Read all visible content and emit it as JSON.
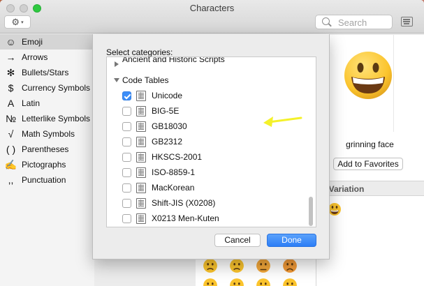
{
  "window": {
    "title": "Characters"
  },
  "toolbar": {
    "search_placeholder": "Search"
  },
  "sidebar": {
    "items": [
      {
        "label": "Emoji",
        "icon": "☺",
        "icon_name": "smiley-icon",
        "selected": true
      },
      {
        "label": "Arrows",
        "icon": "→",
        "icon_name": "arrow-icon"
      },
      {
        "label": "Bullets/Stars",
        "icon": "✻",
        "icon_name": "asterisk-icon"
      },
      {
        "label": "Currency Symbols",
        "icon": "$",
        "icon_name": "dollar-icon"
      },
      {
        "label": "Latin",
        "icon": "A",
        "icon_name": "latin-a-icon"
      },
      {
        "label": "Letterlike Symbols",
        "icon": "№",
        "icon_name": "numero-icon"
      },
      {
        "label": "Math Symbols",
        "icon": "√",
        "icon_name": "square-root-icon"
      },
      {
        "label": "Parentheses",
        "icon": "( )",
        "icon_name": "parentheses-icon"
      },
      {
        "label": "Pictographs",
        "icon": "✍",
        "icon_name": "writing-hand-icon"
      },
      {
        "label": "Punctuation",
        "icon": ",,",
        "icon_name": "punctuation-icon"
      }
    ]
  },
  "detail": {
    "character_name": "grinning face",
    "favorites_button": "Add to Favorites",
    "font_variation_header": "nt Variation"
  },
  "dialog": {
    "prompt": "Select categories:",
    "group_collapsed": "Ancient and Historic Scripts",
    "group_expanded": "Code Tables",
    "items": [
      {
        "label": "Unicode",
        "checked": true
      },
      {
        "label": "BIG-5E",
        "checked": false
      },
      {
        "label": "GB18030",
        "checked": false
      },
      {
        "label": "GB2312",
        "checked": false
      },
      {
        "label": "HKSCS-2001",
        "checked": false
      },
      {
        "label": "ISO-8859-1",
        "checked": false
      },
      {
        "label": "MacKorean",
        "checked": false
      },
      {
        "label": "Shift-JIS (X0208)",
        "checked": false
      },
      {
        "label": "X0213 Men-Kuten",
        "checked": false
      }
    ],
    "cancel_label": "Cancel",
    "done_label": "Done"
  },
  "colors": {
    "accent": "#3d8ef8",
    "annotation_arrow": "#f4f12a",
    "emoji_yellow": "#fbc42d"
  }
}
